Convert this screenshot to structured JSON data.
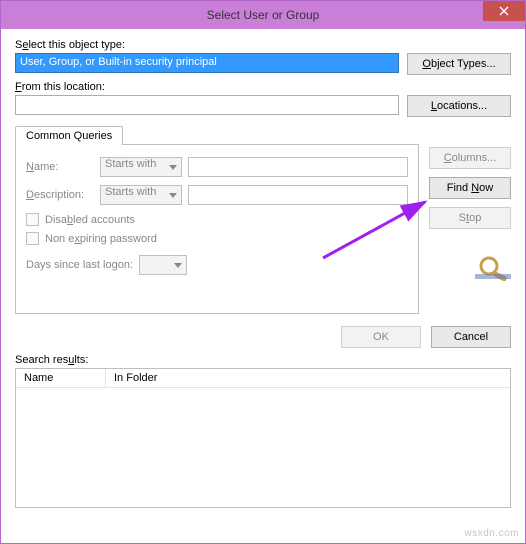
{
  "window": {
    "title": "Select User or Group"
  },
  "section1": {
    "label_pre": "S",
    "label_u": "e",
    "label_post": "lect this object type:",
    "value": "User, Group, or Built-in security principal",
    "btn_pre": "",
    "btn_u": "O",
    "btn_post": "bject Types..."
  },
  "section2": {
    "label_pre": "",
    "label_u": "F",
    "label_post": "rom this location:",
    "value": "",
    "btn_pre": "",
    "btn_u": "L",
    "btn_post": "ocations..."
  },
  "tab": {
    "label": "Common Queries"
  },
  "query": {
    "name_label_u": "N",
    "name_label_post": "ame:",
    "name_op": "Starts with",
    "desc_label_pre": "",
    "desc_label_u": "D",
    "desc_label_post": "escription:",
    "desc_op": "Starts with",
    "chk_disabled_pre": "Disa",
    "chk_disabled_u": "b",
    "chk_disabled_post": "led accounts",
    "chk_nonexp_pre": "Non e",
    "chk_nonexp_u": "x",
    "chk_nonexp_post": "piring password",
    "days_label_pre": "Days since last logon:",
    "days_label_u": "",
    "days_label_post": ""
  },
  "side": {
    "columns_u": "C",
    "columns_post": "olumns...",
    "findnow_pre": "Find ",
    "findnow_u": "N",
    "findnow_post": "ow",
    "stop_pre": "S",
    "stop_u": "t",
    "stop_post": "op"
  },
  "bottom": {
    "ok": "OK",
    "cancel": "Cancel"
  },
  "results": {
    "label_pre": "Search res",
    "label_u": "u",
    "label_post": "lts:",
    "col1": "Name",
    "col2": "In Folder"
  },
  "watermark": "wsxdn.com"
}
